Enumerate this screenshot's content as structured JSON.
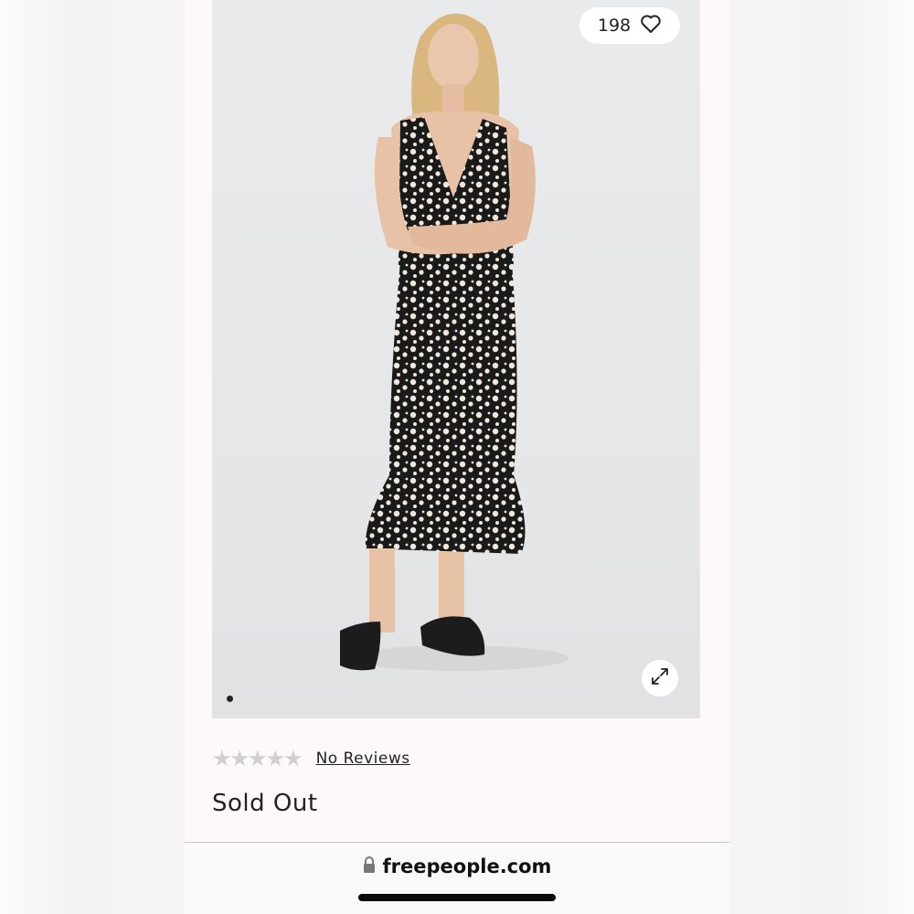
{
  "product": {
    "like_count": "198",
    "rating": 0,
    "stars": "★★★★★",
    "reviews_label": "No Reviews",
    "status": "Sold Out",
    "image_page": 1,
    "image_count": 1
  },
  "browser": {
    "domain": "freepeople.com"
  },
  "colors": {
    "background": "#fcf9f8",
    "image_bg": "#e8e9eb",
    "text": "#222222",
    "star_inactive": "#cfcfcf"
  },
  "icons": {
    "like": "heart-icon",
    "expand": "expand-icon",
    "lock": "lock-icon"
  }
}
